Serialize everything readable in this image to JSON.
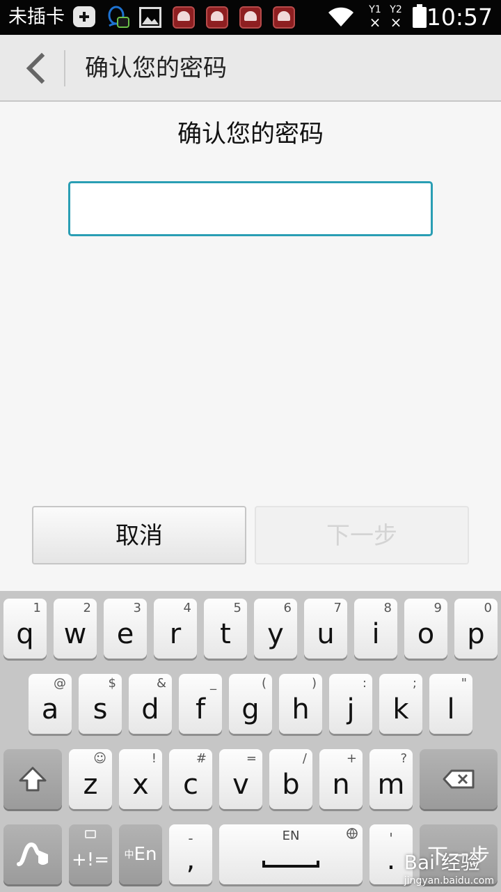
{
  "status_bar": {
    "carrier": "未插卡",
    "sim1": "Y1",
    "sim2": "Y2",
    "sim_state": "×",
    "time": "10:57",
    "icons": [
      "add-icon",
      "qq-icon",
      "image-icon",
      "huawei-app-icon",
      "huawei-app-icon",
      "huawei-app-icon",
      "huawei-app-icon",
      "wifi-icon",
      "battery-icon"
    ]
  },
  "action_bar": {
    "title": "确认您的密码"
  },
  "content": {
    "heading": "确认您的密码",
    "password_value": "",
    "focus_color": "#2a9eb4"
  },
  "buttons": {
    "cancel": "取消",
    "next": "下一步"
  },
  "keyboard": {
    "row1": [
      {
        "k": "q",
        "s": "1"
      },
      {
        "k": "w",
        "s": "2"
      },
      {
        "k": "e",
        "s": "3"
      },
      {
        "k": "r",
        "s": "4"
      },
      {
        "k": "t",
        "s": "5"
      },
      {
        "k": "y",
        "s": "6"
      },
      {
        "k": "u",
        "s": "7"
      },
      {
        "k": "i",
        "s": "8"
      },
      {
        "k": "o",
        "s": "9"
      },
      {
        "k": "p",
        "s": "0"
      }
    ],
    "row2": [
      {
        "k": "a",
        "s": "@"
      },
      {
        "k": "s",
        "s": "$"
      },
      {
        "k": "d",
        "s": "&"
      },
      {
        "k": "f",
        "s": "_"
      },
      {
        "k": "g",
        "s": "("
      },
      {
        "k": "h",
        "s": ")"
      },
      {
        "k": "j",
        "s": ":"
      },
      {
        "k": "k",
        "s": ";"
      },
      {
        "k": "l",
        "s": "\""
      }
    ],
    "row3": [
      {
        "k": "z",
        "s": "☺"
      },
      {
        "k": "x",
        "s": "!"
      },
      {
        "k": "c",
        "s": "#"
      },
      {
        "k": "v",
        "s": "="
      },
      {
        "k": "b",
        "s": "/"
      },
      {
        "k": "n",
        "s": "+"
      },
      {
        "k": "m",
        "s": "?"
      }
    ],
    "symbols_label": "+!=",
    "lang_switch_prefix": "中",
    "lang_switch_label": "En",
    "comma_main": ",",
    "comma_sub": "-",
    "space_label": "EN",
    "period_main": ".",
    "period_sub": "'",
    "enter_label": "下一步",
    "watermark": "Bai 经验",
    "watermark_url": "jingyan.baidu.com"
  }
}
